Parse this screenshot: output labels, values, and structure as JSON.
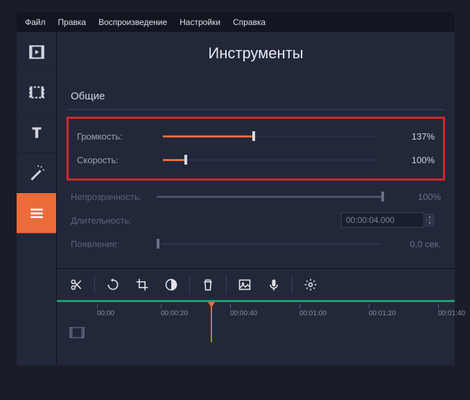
{
  "menu": {
    "file": "Файл",
    "edit": "Правка",
    "playback": "Воспроизведение",
    "settings": "Настройки",
    "help": "Справка"
  },
  "panel": {
    "title": "Инструменты"
  },
  "section": {
    "general": "Общие"
  },
  "rows": {
    "volume": {
      "label": "Громкость:",
      "value": "137%",
      "fill": 42
    },
    "speed": {
      "label": "Скорость:",
      "value": "100%",
      "fill": 10
    },
    "opacity": {
      "label": "Непрозрачность:",
      "value": "100%",
      "fill": 100
    },
    "duration": {
      "label": "Длительность:",
      "value": "00:00:04.000"
    },
    "appearance": {
      "label": "Появление:",
      "value": "0,0 сек.",
      "fill": 0
    }
  },
  "ruler": {
    "ticks": [
      "00:00",
      "00:00:20",
      "00:00:40",
      "00:01:00",
      "00:01:20",
      "00:01:40"
    ]
  }
}
